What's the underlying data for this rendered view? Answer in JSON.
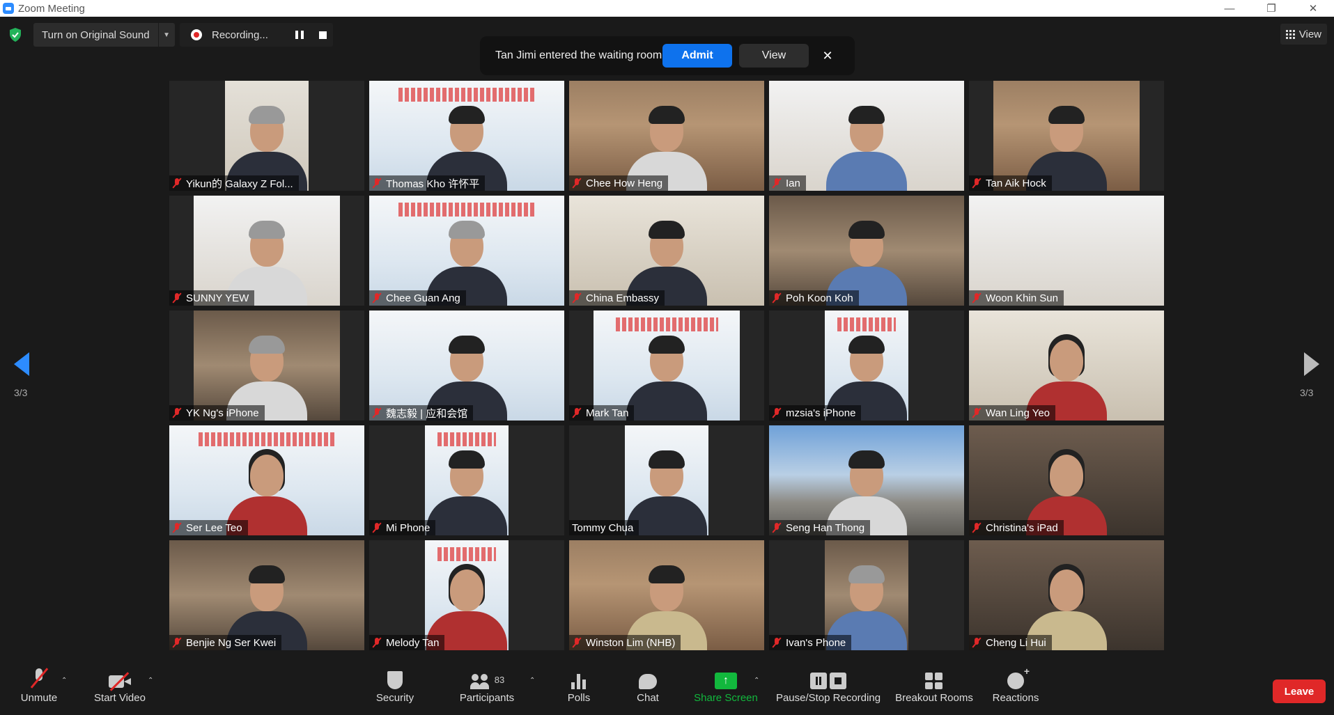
{
  "window": {
    "title": "Zoom Meeting",
    "minimize": "—",
    "restore": "❐",
    "close": "✕"
  },
  "topbar": {
    "original_sound": "Turn on Original Sound",
    "dropdown_glyph": "▼",
    "recording_status": "Recording...",
    "view_label": "View"
  },
  "notice": {
    "message": "Tan Jimi entered the waiting room",
    "admit": "Admit",
    "view": "View",
    "close": "✕"
  },
  "pager": {
    "left_label": "3/3",
    "right_label": "3/3"
  },
  "participants": [
    {
      "name": "Yikun的 Galaxy Z Fol...",
      "muted": true
    },
    {
      "name": "Thomas Kho 许怀平",
      "muted": true
    },
    {
      "name": "Chee How Heng",
      "muted": true
    },
    {
      "name": "Ian",
      "muted": true
    },
    {
      "name": "Tan Aik Hock",
      "muted": true
    },
    {
      "name": "SUNNY YEW",
      "muted": true
    },
    {
      "name": "Chee Guan Ang",
      "muted": true
    },
    {
      "name": "China Embassy",
      "muted": true
    },
    {
      "name": "Poh Koon Koh",
      "muted": true
    },
    {
      "name": "Woon Khin Sun",
      "muted": true
    },
    {
      "name": "YK Ng's iPhone",
      "muted": true
    },
    {
      "name": "魏志毅 | 应和会馆",
      "muted": true
    },
    {
      "name": "Mark Tan",
      "muted": true
    },
    {
      "name": "mzsia's iPhone",
      "muted": true
    },
    {
      "name": "Wan Ling Yeo",
      "muted": true
    },
    {
      "name": "Ser Lee Teo",
      "muted": true
    },
    {
      "name": "Mi Phone",
      "muted": true
    },
    {
      "name": "Tommy Chua",
      "muted": false
    },
    {
      "name": "Seng Han Thong",
      "muted": true
    },
    {
      "name": "Christina's iPad",
      "muted": true
    },
    {
      "name": "Benjie Ng Ser Kwei",
      "muted": true
    },
    {
      "name": "Melody Tan",
      "muted": true
    },
    {
      "name": "Winston Lim (NHB)",
      "muted": true
    },
    {
      "name": "Ivan's Phone",
      "muted": true
    },
    {
      "name": "Cheng Li Hui",
      "muted": true
    }
  ],
  "toolbar": {
    "unmute": "Unmute",
    "start_video": "Start Video",
    "security": "Security",
    "participants": "Participants",
    "participant_count": "83",
    "polls": "Polls",
    "chat": "Chat",
    "share_screen": "Share Screen",
    "pause_stop_recording": "Pause/Stop Recording",
    "breakout_rooms": "Breakout Rooms",
    "reactions": "Reactions",
    "leave": "Leave",
    "caret": "⌃",
    "share_glyph": "↑"
  },
  "colors": {
    "accent_blue": "#0e72ed",
    "leave_red": "#e02828",
    "share_green": "#12b83d",
    "background": "#1a1a1a"
  }
}
